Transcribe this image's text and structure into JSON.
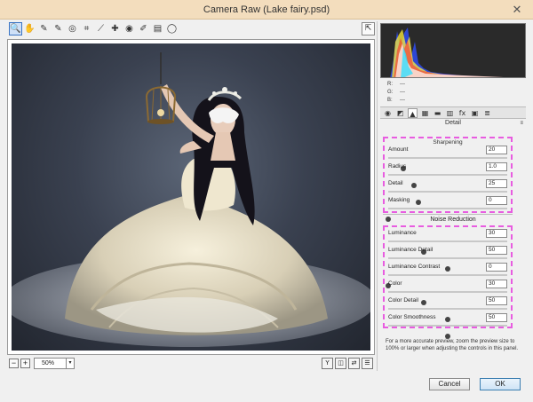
{
  "window": {
    "title": "Camera Raw (Lake fairy.psd)",
    "close_glyph": "✕"
  },
  "toolbar": {
    "tools": [
      {
        "icon": "zoom-icon",
        "glyph": "🔍",
        "active": true
      },
      {
        "icon": "hand-icon",
        "glyph": "✋"
      },
      {
        "icon": "white-balance-icon",
        "glyph": "✎"
      },
      {
        "icon": "color-sampler-icon",
        "glyph": "✎"
      },
      {
        "icon": "targeted-adjustment-icon",
        "glyph": "◎"
      },
      {
        "icon": "crop-icon",
        "glyph": "⌗"
      },
      {
        "icon": "straighten-icon",
        "glyph": "⟋"
      },
      {
        "icon": "spot-removal-icon",
        "glyph": "✚"
      },
      {
        "icon": "red-eye-icon",
        "glyph": "◉"
      },
      {
        "icon": "adjustment-brush-icon",
        "glyph": "✐"
      },
      {
        "icon": "graduated-filter-icon",
        "glyph": "▤"
      },
      {
        "icon": "radial-filter-icon",
        "glyph": "◯"
      }
    ],
    "right_icon": {
      "icon": "open-preferences-icon",
      "glyph": "⇱"
    }
  },
  "zoom": {
    "value": "50%",
    "minus": "−",
    "plus": "+",
    "arrow": "▾"
  },
  "view_buttons": [
    {
      "icon": "preview-toggle-icon",
      "glyph": "Y"
    },
    {
      "icon": "before-after-icon",
      "glyph": "◫"
    },
    {
      "icon": "swap-icon",
      "glyph": "⇄"
    },
    {
      "icon": "settings-icon",
      "glyph": "☰"
    }
  ],
  "rgb_readout": {
    "r_label": "R:",
    "g_label": "G:",
    "b_label": "B:",
    "r": "---",
    "g": "---",
    "b": "---"
  },
  "panel_tabs": [
    {
      "icon": "basic-icon",
      "glyph": "◉"
    },
    {
      "icon": "tone-curve-icon",
      "glyph": "◩"
    },
    {
      "icon": "detail-icon",
      "glyph": "▲",
      "active": true
    },
    {
      "icon": "hsl-icon",
      "glyph": "▦"
    },
    {
      "icon": "split-toning-icon",
      "glyph": "▬"
    },
    {
      "icon": "lens-corrections-icon",
      "glyph": "▥"
    },
    {
      "icon": "effects-icon",
      "glyph": "fx"
    },
    {
      "icon": "camera-calibration-icon",
      "glyph": "▣"
    },
    {
      "icon": "presets-icon",
      "glyph": "≣"
    }
  ],
  "panel": {
    "title": "Detail",
    "menu_glyph": "≡"
  },
  "sharpening": {
    "title": "Sharpening",
    "controls": [
      {
        "label": "Amount",
        "value": "20",
        "level": 0.13
      },
      {
        "label": "Radius",
        "value": "1.0",
        "level": 0.22
      },
      {
        "label": "Detail",
        "value": "25",
        "level": 0.25
      },
      {
        "label": "Masking",
        "value": "0",
        "level": 0.0
      }
    ]
  },
  "noise_reduction": {
    "title": "Noise Reduction",
    "controls": [
      {
        "label": "Luminance",
        "value": "30",
        "level": 0.3
      },
      {
        "label": "Luminance Detail",
        "value": "50",
        "level": 0.5
      },
      {
        "label": "Luminance Contrast",
        "value": "0",
        "level": 0.0
      },
      {
        "label": "Color",
        "value": "30",
        "level": 0.3
      },
      {
        "label": "Color Detail",
        "value": "50",
        "level": 0.5
      },
      {
        "label": "Color Smoothness",
        "value": "50",
        "level": 0.5
      }
    ]
  },
  "hint_text": "For a more accurate preview, zoom the preview size to 100% or larger when adjusting the controls in this panel.",
  "buttons": {
    "cancel": "Cancel",
    "ok": "OK"
  }
}
